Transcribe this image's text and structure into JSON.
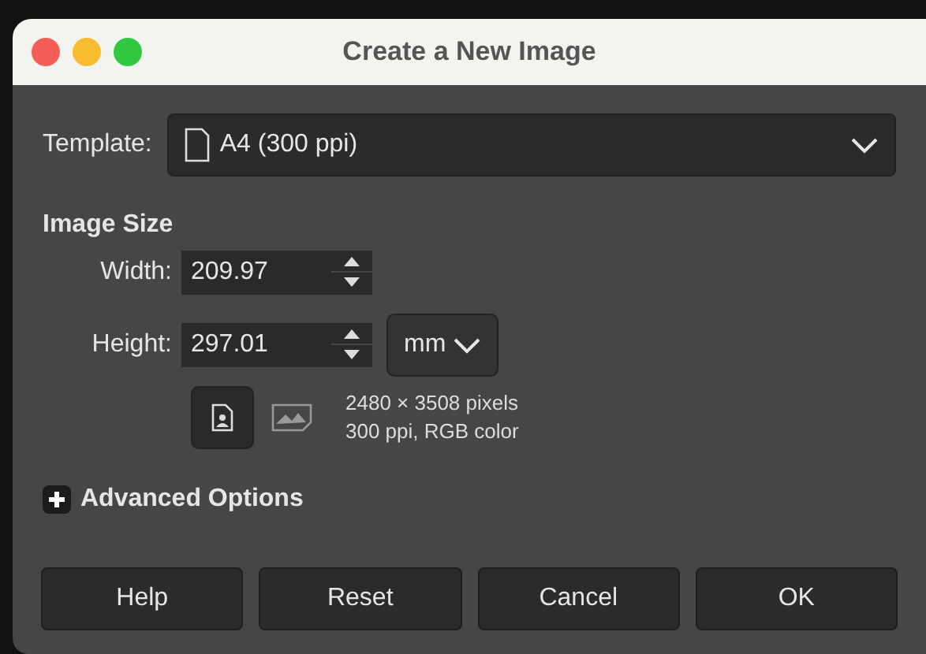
{
  "window": {
    "title": "Create a New Image"
  },
  "template": {
    "label": "Template:",
    "value": "A4 (300 ppi)"
  },
  "image_size": {
    "heading": "Image Size",
    "fields": [
      {
        "label": "Width:",
        "value": "209.97"
      },
      {
        "label": "Height:",
        "value": "297.01"
      }
    ],
    "unit": "mm",
    "orientations": [
      {
        "kind": "portrait",
        "selected": true
      },
      {
        "kind": "landscape",
        "selected": false
      }
    ],
    "info": [
      "2480 × 3508 pixels",
      "300 ppi, RGB color"
    ]
  },
  "advanced": {
    "label": "Advanced Options",
    "expanded": false
  },
  "buttons": [
    "Help",
    "Reset",
    "Cancel",
    "OK"
  ]
}
